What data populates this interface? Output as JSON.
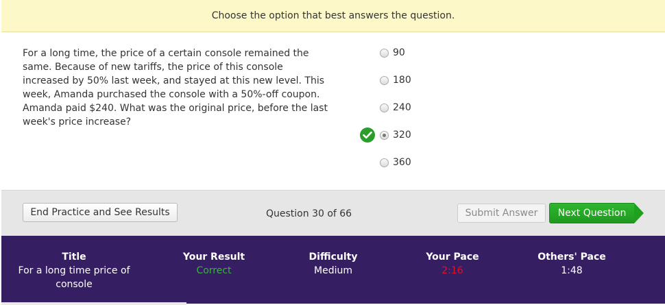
{
  "instruction": "Choose the option that best answers the question.",
  "question": {
    "text": "For a long time, the price of a certain console remained the same. Because of new tariffs, the price of this console increased by 50% last week, and stayed at this new level. This week, Amanda purchased the console with a 50%-off coupon. Amanda paid $240. What was the original price, before the last week's price increase?"
  },
  "options": [
    {
      "label": "90",
      "selected": false,
      "correct": false
    },
    {
      "label": "180",
      "selected": false,
      "correct": false
    },
    {
      "label": "240",
      "selected": false,
      "correct": false
    },
    {
      "label": "320",
      "selected": true,
      "correct": true
    },
    {
      "label": "360",
      "selected": false,
      "correct": false
    }
  ],
  "controls": {
    "end_label": "End Practice and See Results",
    "counter": "Question 30 of 66",
    "submit_label": "Submit Answer",
    "next_label": "Next Question"
  },
  "stats": {
    "title_head": "Title",
    "title_value": "For a long time price of console",
    "result_head": "Your Result",
    "result_value": "Correct",
    "difficulty_head": "Difficulty",
    "difficulty_value": "Medium",
    "pace_head": "Your Pace",
    "pace_value": "2:16",
    "others_head": "Others' Pace",
    "others_value": "1:48"
  },
  "colors": {
    "correct": "#3cb043",
    "slow_pace": "#e0102c",
    "stats_bg": "#361e62",
    "instruction_bg": "#fdf8c8",
    "next_button": "#1fa01f"
  },
  "icons": {
    "correct_marker": "check-circle-icon"
  }
}
